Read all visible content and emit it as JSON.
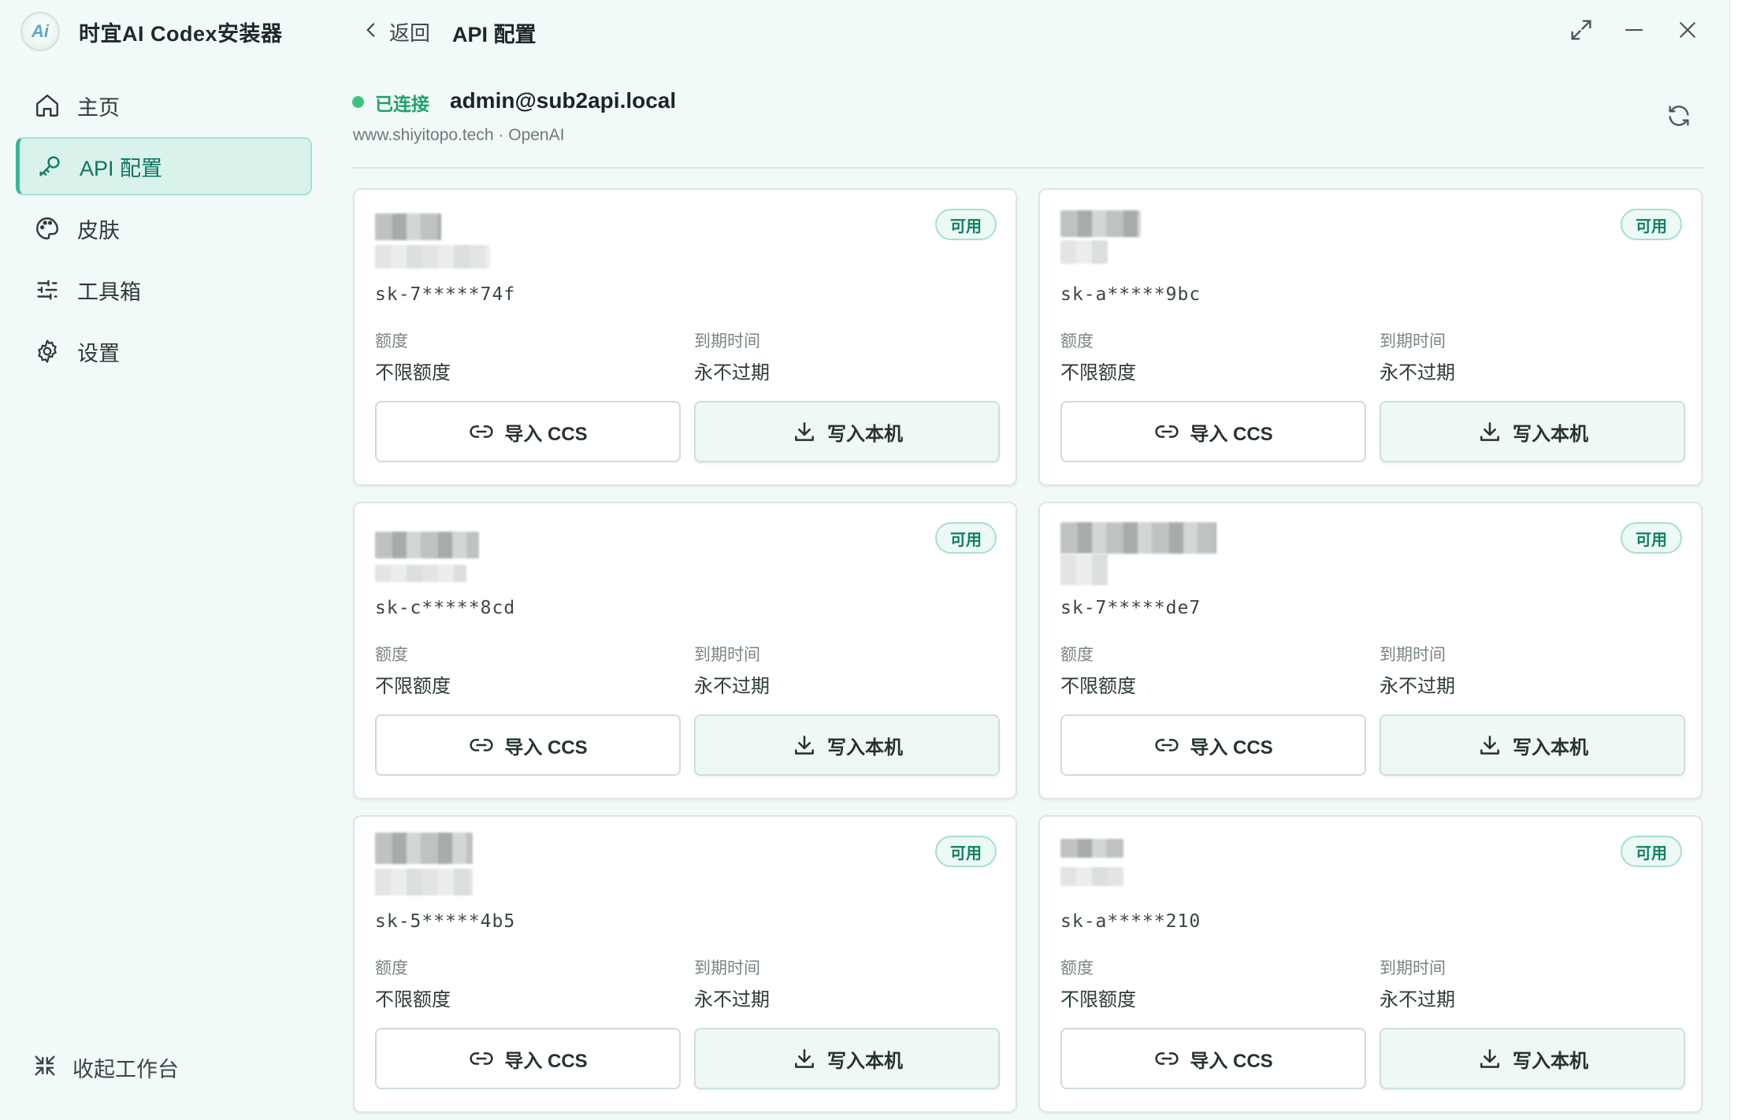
{
  "app": {
    "title": "时宜AI Codex安装器",
    "logo_text": "Ai"
  },
  "sidebar": {
    "items": [
      {
        "label": "主页",
        "icon": "home-icon"
      },
      {
        "label": "API 配置",
        "icon": "key-icon",
        "active": true
      },
      {
        "label": "皮肤",
        "icon": "palette-icon"
      },
      {
        "label": "工具箱",
        "icon": "sliders-icon"
      },
      {
        "label": "设置",
        "icon": "gear-icon"
      }
    ],
    "collapse_label": "收起工作台"
  },
  "header": {
    "back_label": "返回",
    "title": "API 配置"
  },
  "connection": {
    "status": "已连接",
    "account": "admin@sub2api.local",
    "sub_line": "www.shiyitopo.tech · OpenAI"
  },
  "cards": [
    {
      "key": "sk-7*****74f",
      "badge": "可用",
      "quota_label": "额度",
      "quota": "不限额度",
      "expire_label": "到期时间",
      "expire": "永不过期",
      "import_label": "导入 CCS",
      "write_label": "写入本机"
    },
    {
      "key": "sk-a*****9bc",
      "badge": "可用",
      "quota_label": "额度",
      "quota": "不限额度",
      "expire_label": "到期时间",
      "expire": "永不过期",
      "import_label": "导入 CCS",
      "write_label": "写入本机"
    },
    {
      "key": "sk-c*****8cd",
      "badge": "可用",
      "quota_label": "额度",
      "quota": "不限额度",
      "expire_label": "到期时间",
      "expire": "永不过期",
      "import_label": "导入 CCS",
      "write_label": "写入本机"
    },
    {
      "key": "sk-7*****de7",
      "badge": "可用",
      "quota_label": "额度",
      "quota": "不限额度",
      "expire_label": "到期时间",
      "expire": "永不过期",
      "import_label": "导入 CCS",
      "write_label": "写入本机"
    },
    {
      "key": "sk-5*****4b5",
      "badge": "可用",
      "quota_label": "额度",
      "quota": "不限额度",
      "expire_label": "到期时间",
      "expire": "永不过期",
      "import_label": "导入 CCS",
      "write_label": "写入本机"
    },
    {
      "key": "sk-a*****210",
      "badge": "可用",
      "quota_label": "额度",
      "quota": "不限额度",
      "expire_label": "到期时间",
      "expire": "永不过期",
      "import_label": "导入 CCS",
      "write_label": "写入本机"
    }
  ],
  "colors": {
    "background": "#f1faf8",
    "accent": "#35b89a",
    "status_green": "#3cc47f",
    "badge_text": "#108066"
  }
}
